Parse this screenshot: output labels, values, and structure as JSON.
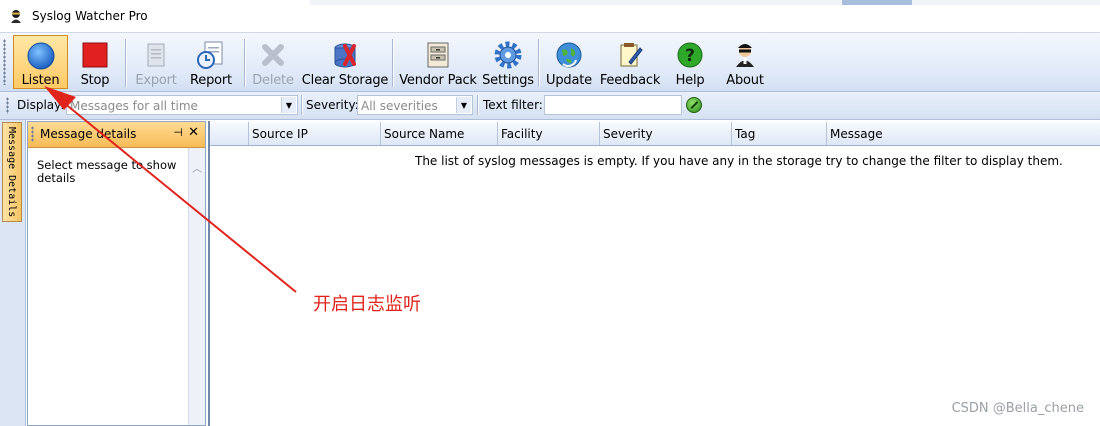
{
  "window": {
    "title": "Syslog Watcher Pro"
  },
  "toolbar": {
    "buttons": [
      {
        "id": "listen",
        "label": "Listen",
        "icon": "circle-blue-icon",
        "enabled": true,
        "active": true
      },
      {
        "id": "stop",
        "label": "Stop",
        "icon": "square-red-icon",
        "enabled": true
      },
      {
        "id": "export",
        "label": "Export",
        "icon": "document-export-icon",
        "enabled": false
      },
      {
        "id": "report",
        "label": "Report",
        "icon": "report-clock-icon",
        "enabled": true
      },
      {
        "id": "delete",
        "label": "Delete",
        "icon": "delete-x-icon",
        "enabled": false
      },
      {
        "id": "clear_storage",
        "label": "Clear Storage",
        "icon": "database-clear-icon",
        "enabled": true
      },
      {
        "id": "vendor_pack",
        "label": "Vendor Pack",
        "icon": "cabinet-icon",
        "enabled": true
      },
      {
        "id": "settings",
        "label": "Settings",
        "icon": "gear-icon",
        "enabled": true
      },
      {
        "id": "update",
        "label": "Update",
        "icon": "globe-update-icon",
        "enabled": true
      },
      {
        "id": "feedback",
        "label": "Feedback",
        "icon": "notepad-pen-icon",
        "enabled": true
      },
      {
        "id": "help",
        "label": "Help",
        "icon": "question-icon",
        "enabled": true
      },
      {
        "id": "about",
        "label": "About",
        "icon": "agent-icon",
        "enabled": true
      }
    ]
  },
  "filterbar": {
    "display_label": "Display:",
    "display_value": "Messages for all time",
    "severity_label": "Severity:",
    "severity_value": "All severities",
    "text_filter_label": "Text filter:",
    "text_filter_value": ""
  },
  "sidetab": {
    "label": "Message Details"
  },
  "details_panel": {
    "title": "Message details",
    "body": "Select message to show details"
  },
  "grid": {
    "columns": [
      "Source IP",
      "Source Name",
      "Facility",
      "Severity",
      "Tag",
      "Message"
    ],
    "empty_message": "The list of syslog messages is empty. If you have any in the storage try to change the filter to display them."
  },
  "annotation": {
    "text": "开启日志监听"
  },
  "watermark": {
    "text": "CSDN @Bella_chene"
  },
  "colors": {
    "accent_orange": "#f7bb55",
    "annotation_red": "#e0241c",
    "toolbar_blue": "#dfe9f7"
  }
}
